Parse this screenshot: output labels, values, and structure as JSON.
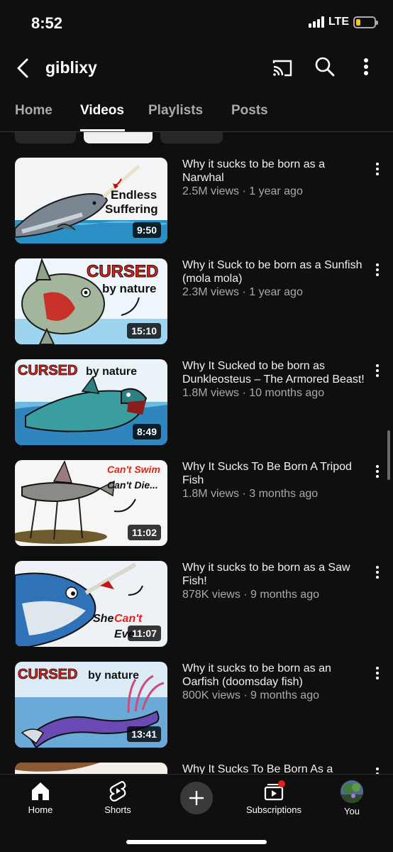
{
  "status": {
    "time": "8:52",
    "network": "LTE",
    "battery_level": 0.25
  },
  "header": {
    "channel_name": "giblixy"
  },
  "tabs": [
    {
      "label": "Home"
    },
    {
      "label": "Videos"
    },
    {
      "label": "Playlists"
    },
    {
      "label": "Posts"
    }
  ],
  "active_tab": "Videos",
  "videos": [
    {
      "title": "Why it sucks to be born as a Narwhal",
      "meta": "2.5M views · 1 year ago",
      "duration": "9:50",
      "thumb_text": [
        "Endless",
        "Suffering"
      ]
    },
    {
      "title": "Why it Suck to be born as a Sunfish (mola mola)",
      "meta": "2.3M views · 1 year ago",
      "duration": "15:10",
      "thumb_text": [
        "CURSED",
        "by nature"
      ]
    },
    {
      "title": "Why It Sucked to be born as Dunkleosteus – The Armored Beast!",
      "meta": "1.8M views · 10 months ago",
      "duration": "8:49",
      "thumb_text": [
        "CURSED",
        "by nature"
      ]
    },
    {
      "title": "Why It Sucks To Be Born A Tripod Fish",
      "meta": "1.8M views · 3 months ago",
      "duration": "11:02",
      "thumb_text": [
        "Can't Swim",
        "Can't Die..."
      ]
    },
    {
      "title": "Why it sucks to be born as a Saw Fish!",
      "meta": "878K views · 9 months ago",
      "duration": "11:07",
      "thumb_text": [
        "She",
        "Can't",
        "Eve"
      ]
    },
    {
      "title": "Why it sucks to be born as an Oarfish (doomsday fish)",
      "meta": "800K views · 9 months ago",
      "duration": "13:41",
      "thumb_text": [
        "CURSED",
        "by nature"
      ]
    },
    {
      "title": "Why It Sucks To Be Born As a",
      "meta": "",
      "duration": "",
      "thumb_text": []
    }
  ],
  "bottom_nav": [
    {
      "label": "Home",
      "icon": "home-icon"
    },
    {
      "label": "Shorts",
      "icon": "shorts-icon"
    },
    {
      "label": "",
      "icon": "add-icon"
    },
    {
      "label": "Subscriptions",
      "icon": "subscriptions-icon"
    },
    {
      "label": "You",
      "icon": "avatar"
    }
  ],
  "colors": {
    "background": "#0f0f0f",
    "accent_red": "#e62117",
    "text_secondary": "#aaaaaa"
  }
}
